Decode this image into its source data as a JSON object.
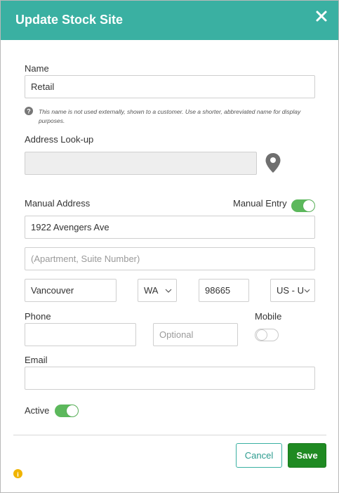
{
  "dialog": {
    "title": "Update Stock Site",
    "close_icon": "close-icon"
  },
  "name": {
    "label": "Name",
    "value": "Retail",
    "hint": "This name is not used externally, shown to a customer. Use a shorter, abbreviated name for display purposes."
  },
  "address_lookup": {
    "label": "Address Look-up",
    "value": "",
    "icon": "map-pin-icon"
  },
  "manual_address": {
    "label": "Manual Address",
    "toggle_label": "Manual Entry",
    "toggle_on": true,
    "line1": "1922 Avengers Ave",
    "line2_placeholder": "(Apartment, Suite Number)",
    "city": "Vancouver",
    "state": "WA",
    "zip": "98665",
    "country": "US - U"
  },
  "phone": {
    "label": "Phone",
    "value": "",
    "ext_placeholder": "Optional",
    "mobile_label": "Mobile",
    "mobile_on": false
  },
  "email": {
    "label": "Email",
    "value": ""
  },
  "active": {
    "label": "Active",
    "on": true
  },
  "footer": {
    "cancel_label": "Cancel",
    "save_label": "Save",
    "info_icon": "info-icon"
  },
  "colors": {
    "header": "#3ab0a2",
    "toggle_on": "#5cb85c",
    "save": "#1f8a22",
    "info": "#f0b400"
  }
}
